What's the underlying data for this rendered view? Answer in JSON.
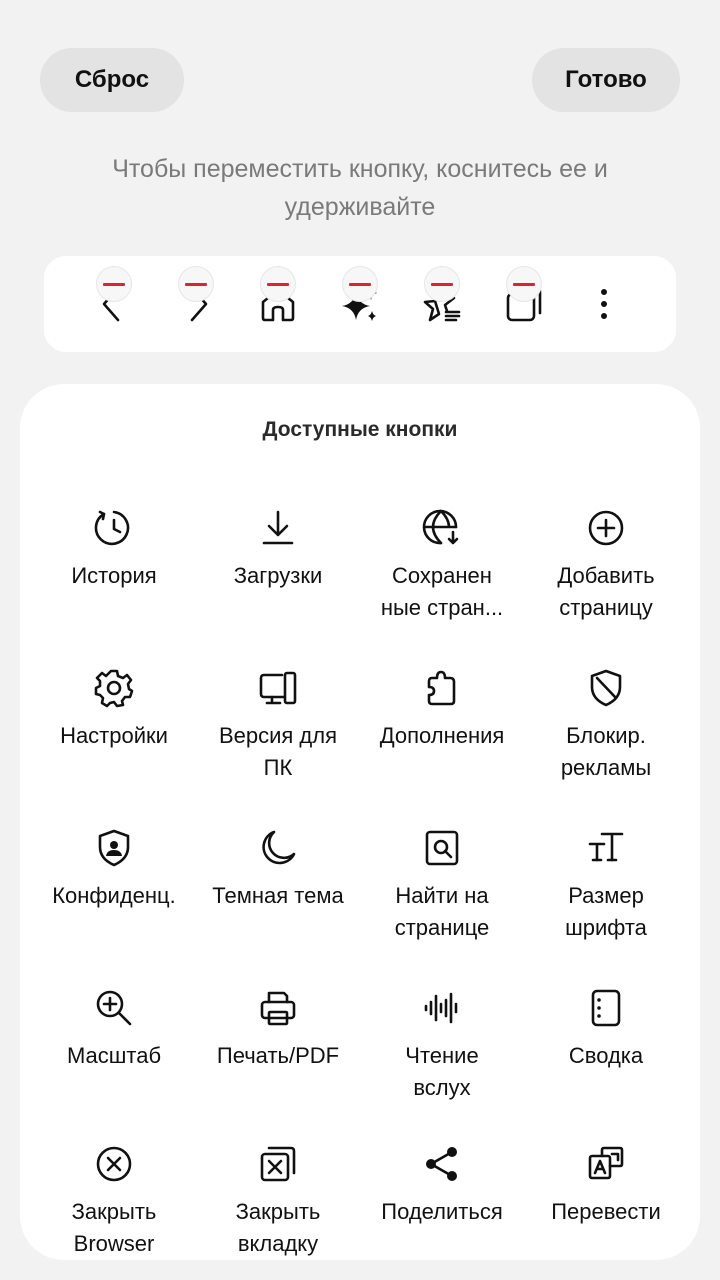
{
  "header": {
    "reset_label": "Сброс",
    "done_label": "Готово"
  },
  "hint_text": "Чтобы переместить кнопку, коснитесь ее и удерживайте",
  "toolbar": {
    "items": [
      {
        "icon": "back-icon"
      },
      {
        "icon": "forward-icon"
      },
      {
        "icon": "home-icon"
      },
      {
        "icon": "sparkle-icon"
      },
      {
        "icon": "bookmarks-icon"
      },
      {
        "icon": "tabs-icon"
      }
    ],
    "more_icon": "more-vertical-icon",
    "remove_badge_color": "#e0222b"
  },
  "available": {
    "title": "Доступные кнопки",
    "items": [
      {
        "label": "История",
        "icon": "history-icon"
      },
      {
        "label": "Загрузки",
        "icon": "download-icon"
      },
      {
        "label": "Сохранен\nные стран...",
        "icon": "saved-pages-icon"
      },
      {
        "label": "Добавить\nстраницу",
        "icon": "add-page-icon"
      },
      {
        "label": "Настройки",
        "icon": "settings-icon"
      },
      {
        "label": "Версия для\nПК",
        "icon": "desktop-version-icon"
      },
      {
        "label": "Дополнения",
        "icon": "extensions-icon"
      },
      {
        "label": "Блокир.\nрекламы",
        "icon": "ad-block-icon"
      },
      {
        "label": "Конфиденц.",
        "icon": "privacy-icon"
      },
      {
        "label": "Темная тема",
        "icon": "dark-mode-icon"
      },
      {
        "label": "Найти на\nстранице",
        "icon": "find-on-page-icon"
      },
      {
        "label": "Размер\nшрифта",
        "icon": "font-size-icon"
      },
      {
        "label": "Масштаб",
        "icon": "zoom-icon"
      },
      {
        "label": "Печать/PDF",
        "icon": "print-icon"
      },
      {
        "label": "Чтение\nвслух",
        "icon": "read-aloud-icon"
      },
      {
        "label": "Сводка",
        "icon": "summary-icon"
      },
      {
        "label": "Закрыть\nBrowser",
        "icon": "close-browser-icon"
      },
      {
        "label": "Закрыть\nвкладку",
        "icon": "close-tab-icon"
      },
      {
        "label": "Поделиться",
        "icon": "share-icon"
      },
      {
        "label": "Перевести",
        "icon": "translate-icon"
      }
    ]
  }
}
